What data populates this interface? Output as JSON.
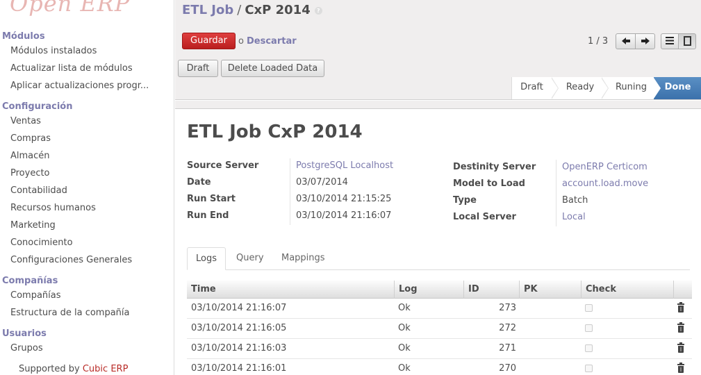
{
  "sidebar": {
    "logo": "Open ERP",
    "sections": [
      {
        "title": "Módulos",
        "items": [
          "Módulos instalados",
          "Actualizar lista de módulos",
          "Aplicar actualizaciones progr..."
        ]
      },
      {
        "title": "Configuración",
        "items": [
          "Ventas",
          "Compras",
          "Almacén",
          "Proyecto",
          "Contabilidad",
          "Recursos humanos",
          "Marketing",
          "Conocimiento",
          "Configuraciones Generales"
        ]
      },
      {
        "title": "Compañías",
        "items": [
          "Compañías",
          "Estructura de la compañía"
        ]
      },
      {
        "title": "Usuarios",
        "items": [
          "Grupos"
        ]
      }
    ],
    "supported_prefix": "Supported by ",
    "supported_brand": "Cubic ERP"
  },
  "breadcrumb": {
    "parent": "ETL Job",
    "separator": "/",
    "current": "CxP 2014",
    "help": "?"
  },
  "toolbar": {
    "save_label": "Guardar",
    "or_label": "o",
    "discard_label": "Descartar"
  },
  "pager": {
    "text": "1 / 3",
    "prev_icon": "arrow-left-icon",
    "next_icon": "arrow-right-icon"
  },
  "header_buttons": {
    "draft": "Draft",
    "delete": "Delete Loaded Data"
  },
  "statusbar": {
    "states": [
      "Draft",
      "Ready",
      "Runing",
      "Done"
    ],
    "active": "Done",
    "active_color": "#4a81bb"
  },
  "record": {
    "title": "ETL Job CxP 2014",
    "left_fields": [
      {
        "label": "Source Server",
        "value": "PostgreSQL Localhost",
        "link": true
      },
      {
        "label": "Date",
        "value": "03/07/2014",
        "link": false
      },
      {
        "label": "Run Start",
        "value": "03/10/2014 21:15:25",
        "link": false
      },
      {
        "label": "Run End",
        "value": "03/10/2014 21:16:07",
        "link": false
      }
    ],
    "right_fields": [
      {
        "label": "Destinity Server",
        "value": "OpenERP Certicom",
        "link": true
      },
      {
        "label": "Model to Load",
        "value": "account.load.move",
        "link": true
      },
      {
        "label": "Type",
        "value": "Batch",
        "link": false
      },
      {
        "label": "Local Server",
        "value": "Local",
        "link": true
      }
    ]
  },
  "tabs": [
    "Logs",
    "Query",
    "Mappings"
  ],
  "active_tab": "Logs",
  "logs_table": {
    "columns": [
      "Time",
      "Log",
      "ID",
      "PK",
      "Check"
    ],
    "rows": [
      {
        "time": "03/10/2014 21:16:07",
        "log": "Ok",
        "id": "273",
        "pk": "",
        "check": false
      },
      {
        "time": "03/10/2014 21:16:05",
        "log": "Ok",
        "id": "272",
        "pk": "",
        "check": false
      },
      {
        "time": "03/10/2014 21:16:03",
        "log": "Ok",
        "id": "271",
        "pk": "",
        "check": false
      },
      {
        "time": "03/10/2014 21:16:01",
        "log": "Ok",
        "id": "270",
        "pk": "",
        "check": false
      }
    ]
  },
  "colors": {
    "accent": "#7c7bad",
    "save": "#c62f2f",
    "brand": "#b92c28"
  }
}
